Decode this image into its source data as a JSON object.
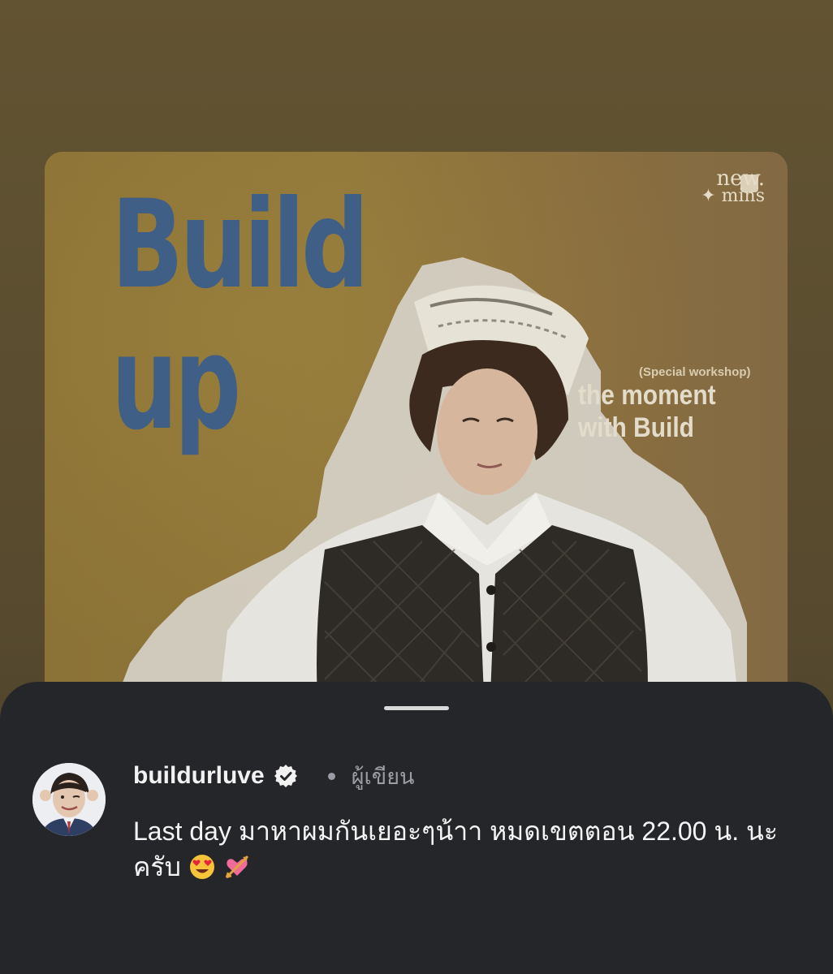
{
  "poster": {
    "title_line1": "Build",
    "title_line2": "up",
    "brand_line1": "new.",
    "brand_line2": "✦ mins",
    "subtitle_small": "(Special workshop)",
    "subtitle_line1": "the moment",
    "subtitle_line2": "with Build"
  },
  "post": {
    "username": "buildurluve",
    "verified": true,
    "role": "ผู้เขียน",
    "caption": "Last day มาหาผมกันเยอะๆน้าา หมดเขตตอน 22.00 น. นะครับ",
    "emoji_1": "heart-eyes-emoji",
    "emoji_2": "heart-with-arrow-emoji"
  },
  "colors": {
    "sheet_bg": "#24262a",
    "poster_title": "#3f5f86",
    "text_primary": "#f2f2f2",
    "text_secondary": "#9a9da3"
  }
}
